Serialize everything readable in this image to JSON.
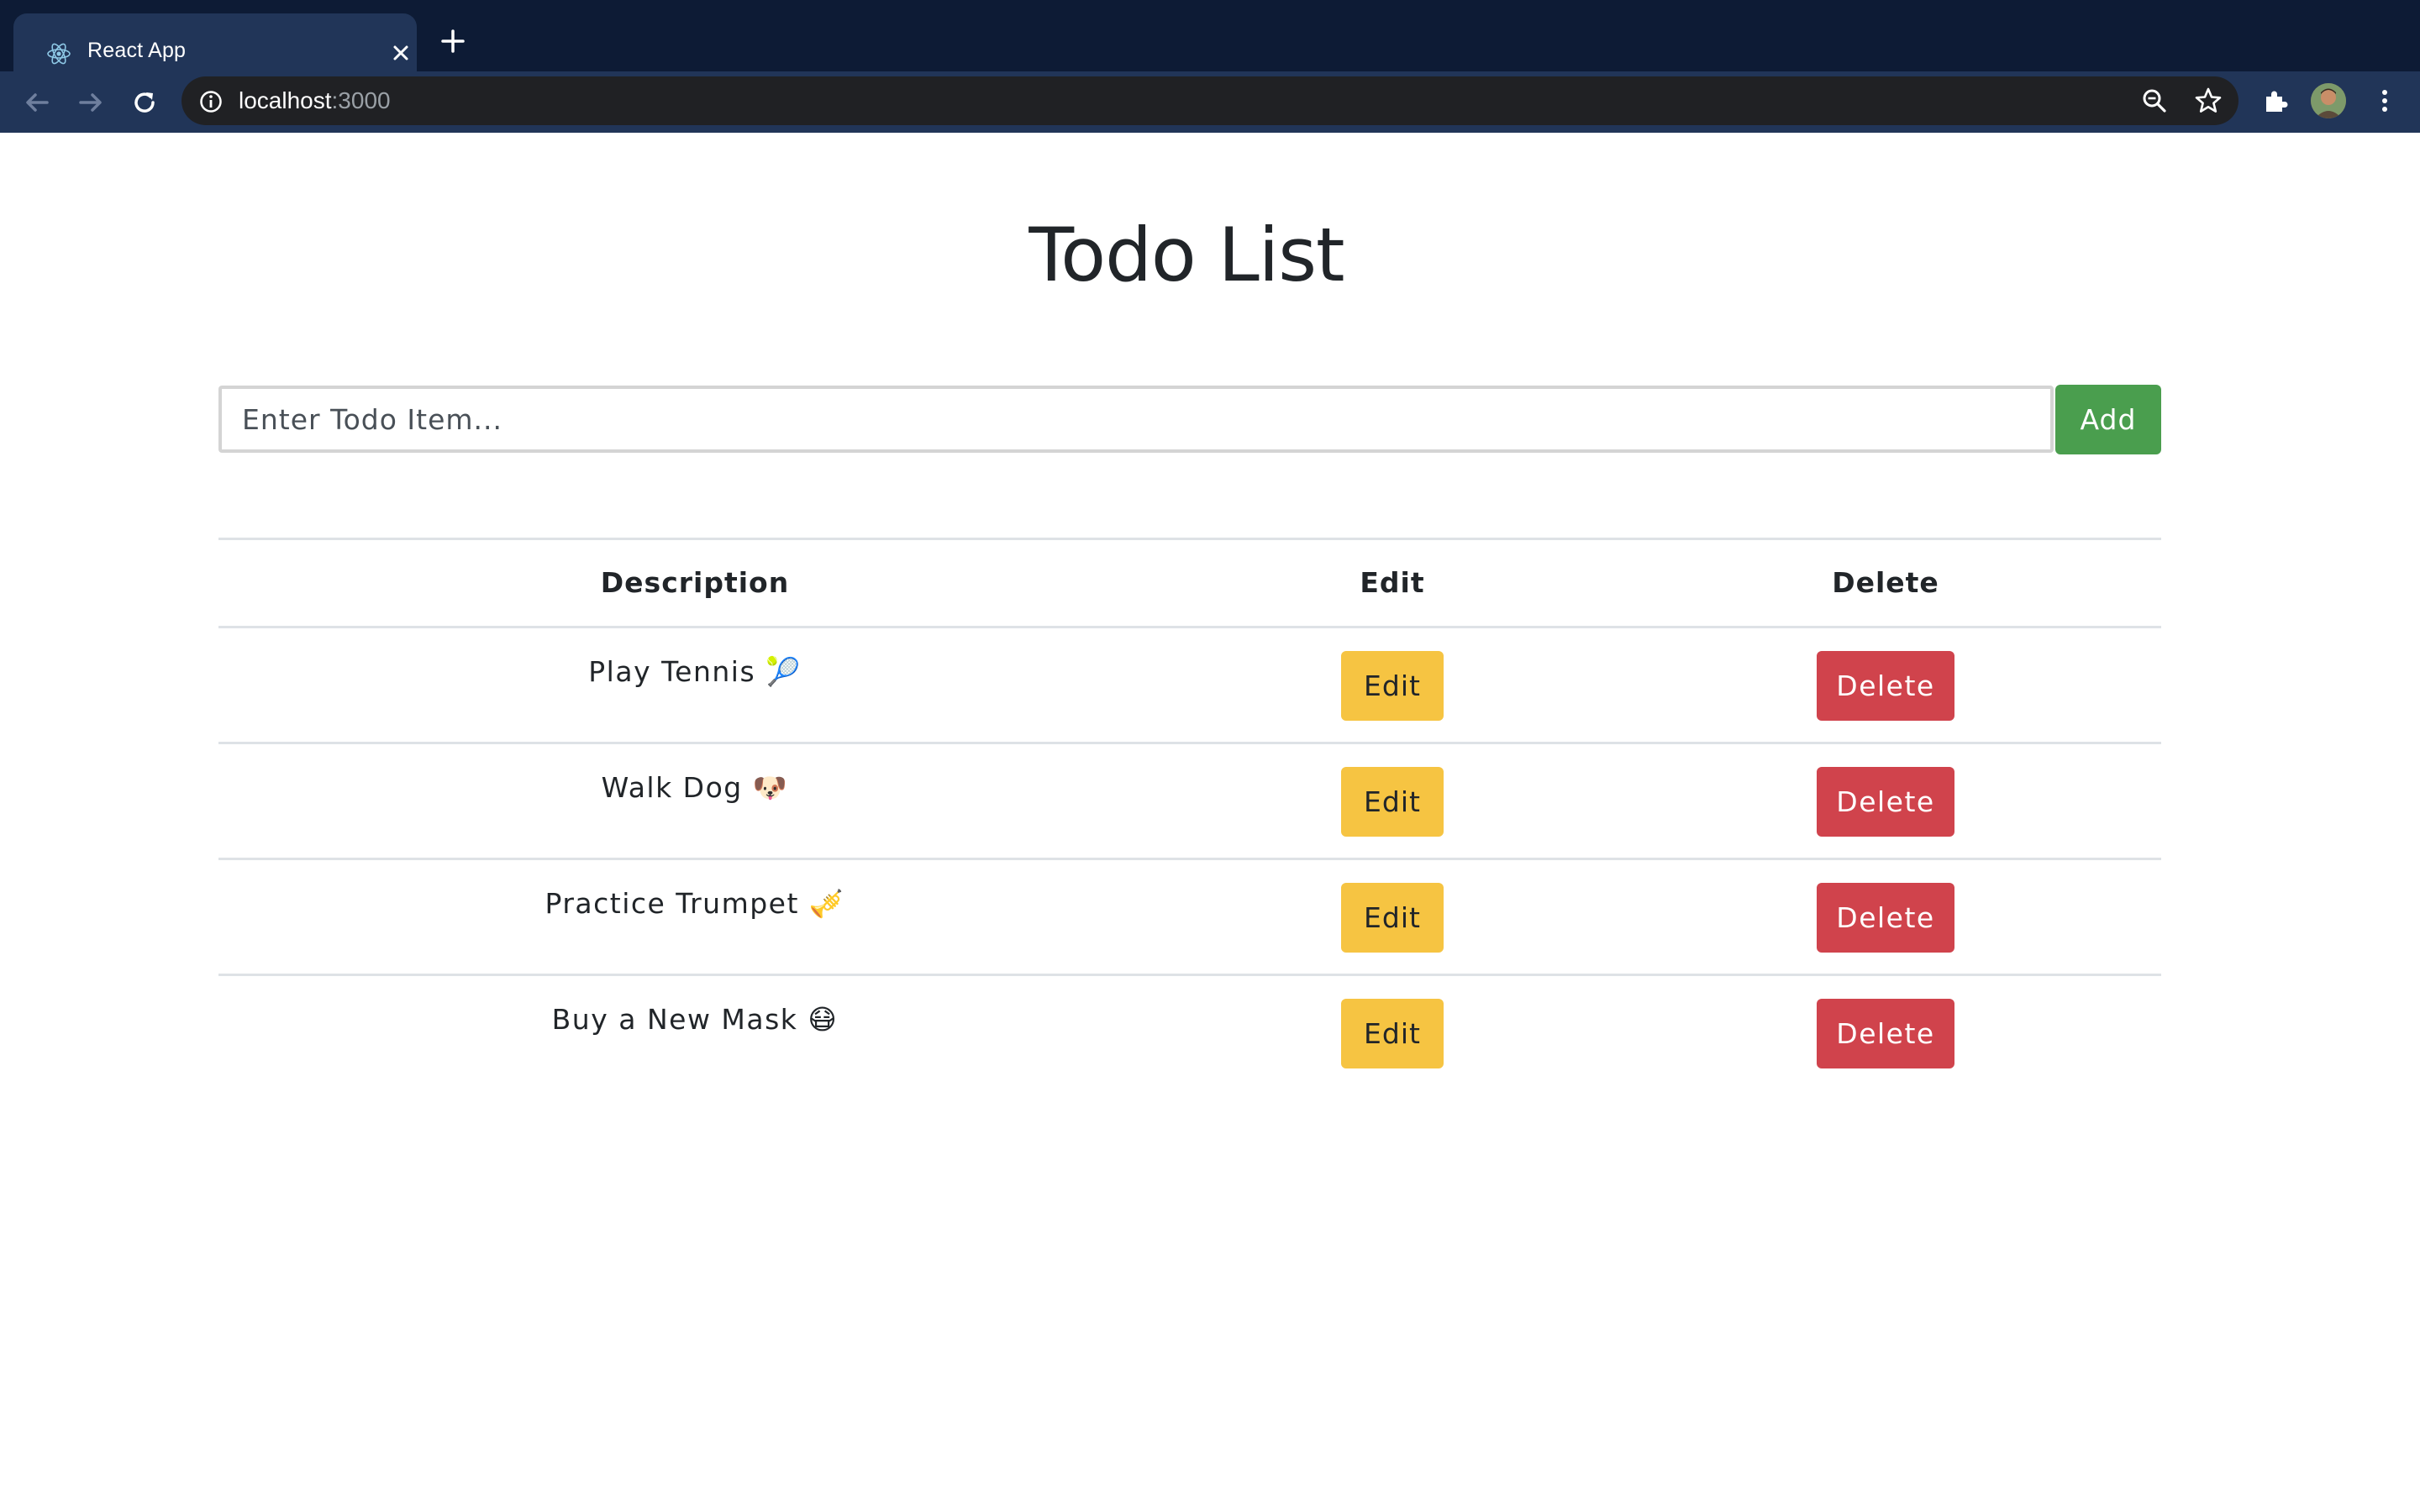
{
  "browser": {
    "tab_title": "React App",
    "url_host": "localhost",
    "url_port": ":3000"
  },
  "page": {
    "title": "Todo List",
    "input_placeholder": "Enter Todo Item...",
    "add_label": "Add"
  },
  "table": {
    "headers": [
      "Description",
      "Edit",
      "Delete"
    ],
    "rows": [
      {
        "description": "Play Tennis 🎾",
        "edit": "Edit",
        "delete": "Delete"
      },
      {
        "description": "Walk Dog 🐶",
        "edit": "Edit",
        "delete": "Delete"
      },
      {
        "description": "Practice Trumpet 🎺",
        "edit": "Edit",
        "delete": "Delete"
      },
      {
        "description": "Buy a New Mask 😷",
        "edit": "Edit",
        "delete": "Delete"
      }
    ]
  },
  "colors": {
    "chrome_bg": "#0d1b35",
    "toolbar_bg": "#213558",
    "add_button": "#4a9e4e",
    "edit_button": "#f6c442",
    "delete_button": "#d0434c"
  },
  "icons": [
    "react-favicon",
    "close-icon",
    "plus-icon",
    "back-arrow-icon",
    "forward-arrow-icon",
    "reload-icon",
    "info-icon",
    "zoom-icon",
    "star-icon",
    "extensions-icon",
    "avatar",
    "menu-dots-icon"
  ]
}
